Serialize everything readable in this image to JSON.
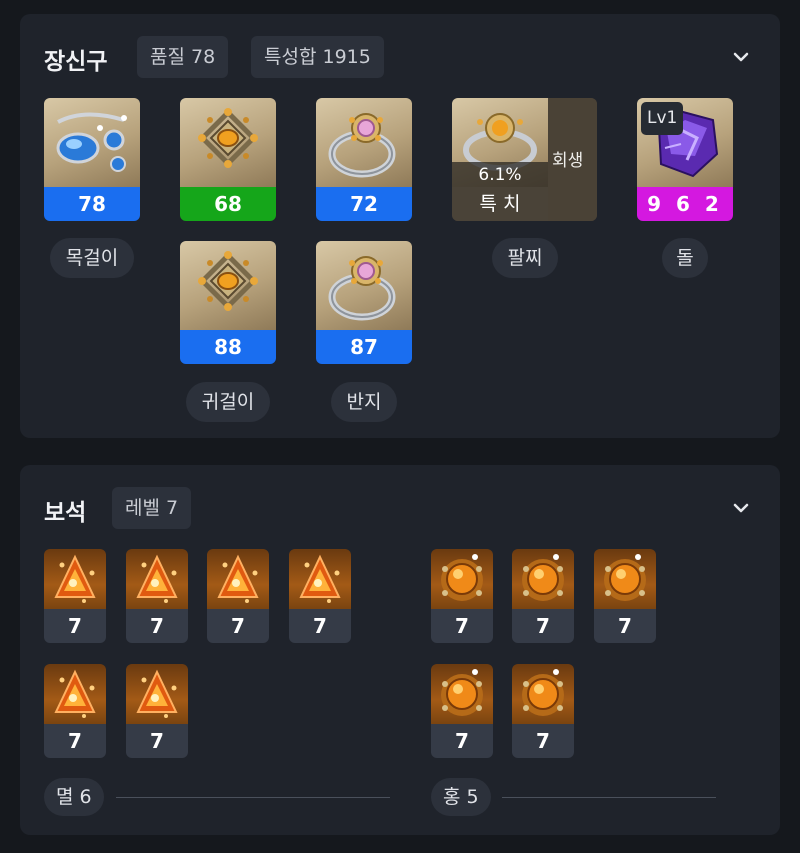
{
  "accessories": {
    "title": "장신구",
    "quality_pill": "품질 78",
    "stats_pill": "특성합 1915",
    "necklace": {
      "quality": "78",
      "label": "목걸이"
    },
    "earring1": {
      "quality": "68"
    },
    "earring2": {
      "quality": "88",
      "label": "귀걸이"
    },
    "ring1": {
      "quality": "72"
    },
    "ring2": {
      "quality": "87",
      "label": "반지"
    },
    "bracelet": {
      "percent": "6.1%",
      "stats": "특 치",
      "effect": "회생",
      "label": "팔찌"
    },
    "stone": {
      "level": "Lv1",
      "value": "9 6 2",
      "label": "돌"
    },
    "colors": {
      "quality_blue": "#1a6ef0",
      "quality_green": "#15a61a",
      "stone_magenta": "#d418e0"
    }
  },
  "gems": {
    "title": "보석",
    "level_pill": "레벨 7",
    "left_group": {
      "levels": [
        "7",
        "7",
        "7",
        "7",
        "7",
        "7"
      ],
      "count_label": "멸 6"
    },
    "right_group": {
      "levels": [
        "7",
        "7",
        "7",
        "7",
        "7"
      ],
      "count_label": "홍 5"
    }
  },
  "icons": [
    "chevron-down-icon",
    "necklace-icon",
    "earring-icon",
    "ring-icon",
    "bracelet-icon",
    "ability-stone-icon",
    "annihilation-gem-icon",
    "crimson-flame-gem-icon"
  ]
}
